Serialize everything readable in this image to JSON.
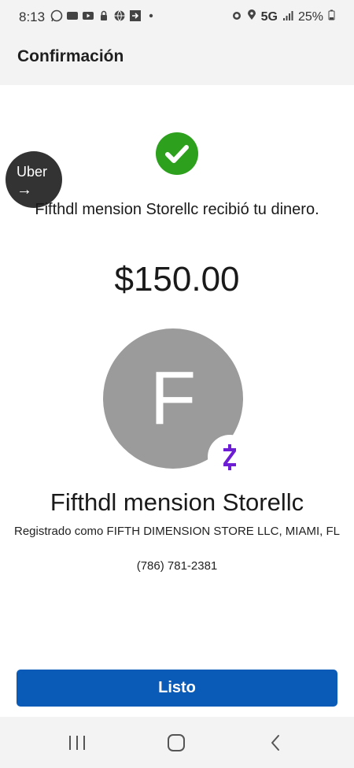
{
  "status_bar": {
    "time": "8:13",
    "left_icons": [
      "whatsapp-icon",
      "temu-icon",
      "youtube-icon",
      "lock-icon",
      "globe-icon",
      "share-icon",
      "dot-icon"
    ],
    "network": "5G",
    "battery": "25%"
  },
  "header": {
    "title": "Confirmación"
  },
  "overlay": {
    "uber_label": "Uber",
    "uber_arrow": "→"
  },
  "confirmation": {
    "message": "Fifthdl mension Storellc recibió tu dinero.",
    "amount": "$150.00"
  },
  "recipient": {
    "initial": "F",
    "name": "Fifthdl mension Storellc",
    "registered": "Registrado como FIFTH DIMENSION STORE LLC, MIAMI, FL",
    "phone": "(786) 781-2381",
    "badge_icon": "zelle-icon"
  },
  "actions": {
    "done_label": "Listo"
  },
  "colors": {
    "primary": "#0a5bb8",
    "success": "#2da11d",
    "zelle": "#6d1ed4",
    "avatar": "#9b9b9b"
  }
}
